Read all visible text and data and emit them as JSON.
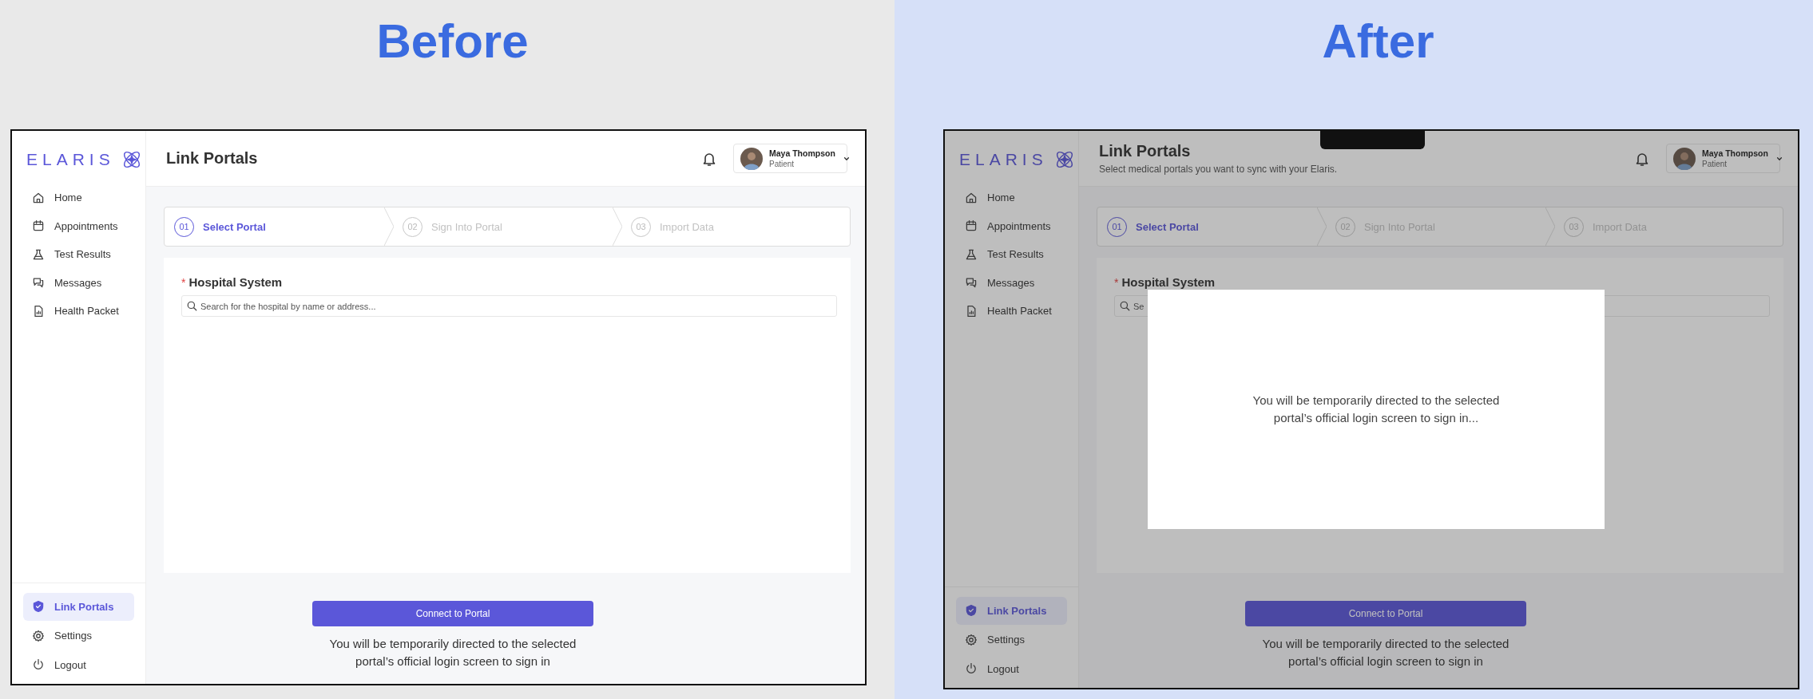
{
  "panels": [
    {
      "heading": "Before",
      "screen": {
        "logo": "ELARIS",
        "page_title": "Link Portals",
        "user": {
          "name": "Maya Thompson",
          "role": "Patient"
        },
        "nav": [
          {
            "label": "Home",
            "selected": false
          },
          {
            "label": "Appointments",
            "selected": false
          },
          {
            "label": "Test Results",
            "selected": false
          },
          {
            "label": "Messages",
            "selected": false
          },
          {
            "label": "Health Packet",
            "selected": false
          }
        ],
        "footer_nav": [
          {
            "label": "Link Portals",
            "selected": true
          },
          {
            "label": "Settings",
            "selected": false
          },
          {
            "label": "Logout",
            "selected": false
          }
        ],
        "steps": [
          {
            "number": "01",
            "label": "Select Portal",
            "selected": true
          },
          {
            "number": "02",
            "label": "Sign Into Portal",
            "selected": false
          },
          {
            "number": "03",
            "label": "Import Data",
            "selected": false
          }
        ],
        "field": {
          "required_mark": "*",
          "label": "Hospital System",
          "placeholder": "Search for the hospital by name or address..."
        },
        "button": "Connect to Portal",
        "note": "You will be temporarily directed to the selected\nportal’s official login screen to sign in",
        "dimmed": false
      }
    },
    {
      "heading": "After",
      "screen": {
        "logo": "ELARIS",
        "page_title": "Link Portals",
        "subtitle": "Select medical portals you want to sync with your Elaris.",
        "user": {
          "name": "Maya Thompson",
          "role": "Patient"
        },
        "nav": [
          {
            "label": "Home",
            "selected": false
          },
          {
            "label": "Appointments",
            "selected": false
          },
          {
            "label": "Test Results",
            "selected": false
          },
          {
            "label": "Messages",
            "selected": false
          },
          {
            "label": "Health Packet",
            "selected": false
          }
        ],
        "footer_nav": [
          {
            "label": "Link Portals",
            "selected": true
          },
          {
            "label": "Settings",
            "selected": false
          },
          {
            "label": "Logout",
            "selected": false
          }
        ],
        "steps": [
          {
            "number": "01",
            "label": "Select Portal",
            "selected": true
          },
          {
            "number": "02",
            "label": "Sign Into Portal",
            "selected": false
          },
          {
            "number": "03",
            "label": "Import Data",
            "selected": false
          }
        ],
        "field": {
          "required_mark": "*",
          "label": "Hospital System",
          "placeholder": "Se"
        },
        "button": "Connect to Portal",
        "note": "You will be temporarily directed to the selected\nportal’s official login screen to sign in",
        "dimmed": true,
        "modal": {
          "text": "You will be temporarily directed to the selected\nportal’s official login screen to sign in..."
        }
      }
    }
  ]
}
